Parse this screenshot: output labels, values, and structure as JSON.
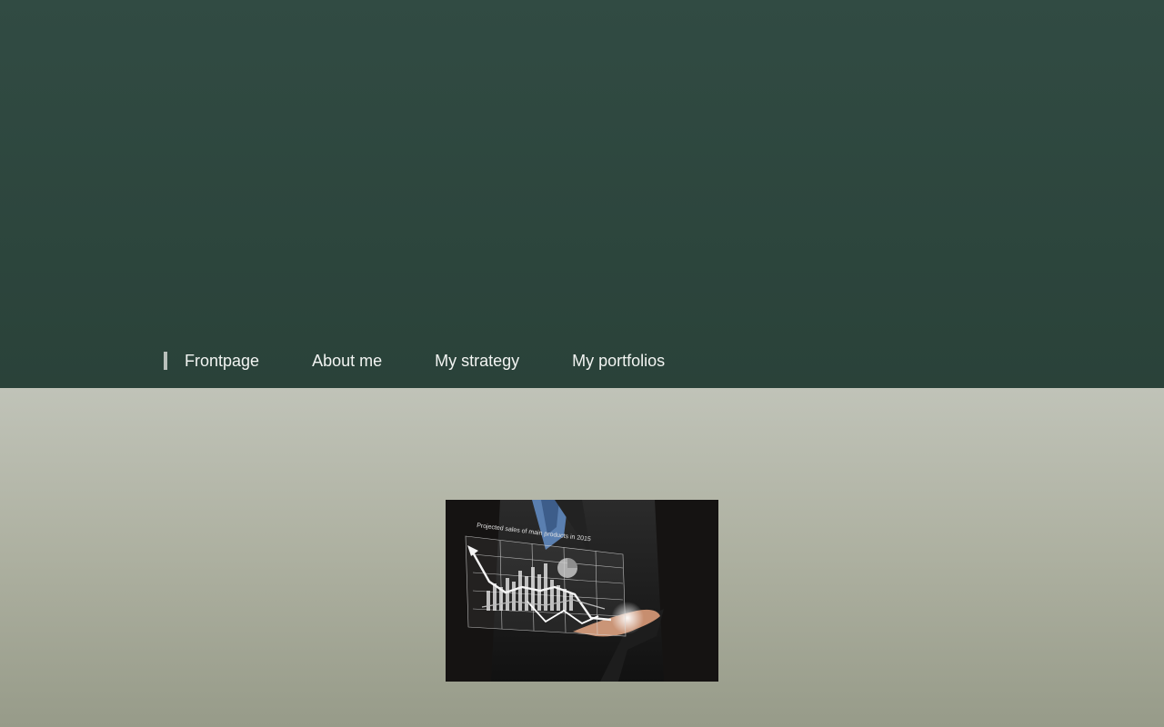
{
  "nav": {
    "items": [
      {
        "label": "Frontpage",
        "active": true
      },
      {
        "label": "About me"
      },
      {
        "label": "My strategy"
      },
      {
        "label": "My portfolios"
      }
    ]
  },
  "hero": {
    "image_text": "Projected sales of main products in 2015",
    "image": "businessman-hand-holding-financial-chart-image"
  },
  "colors": {
    "header_bg": "#2d463e",
    "nav_text": "#f2f4f2",
    "content_bg_top": "#c0c3b8",
    "content_bg_bottom": "#979b89"
  }
}
